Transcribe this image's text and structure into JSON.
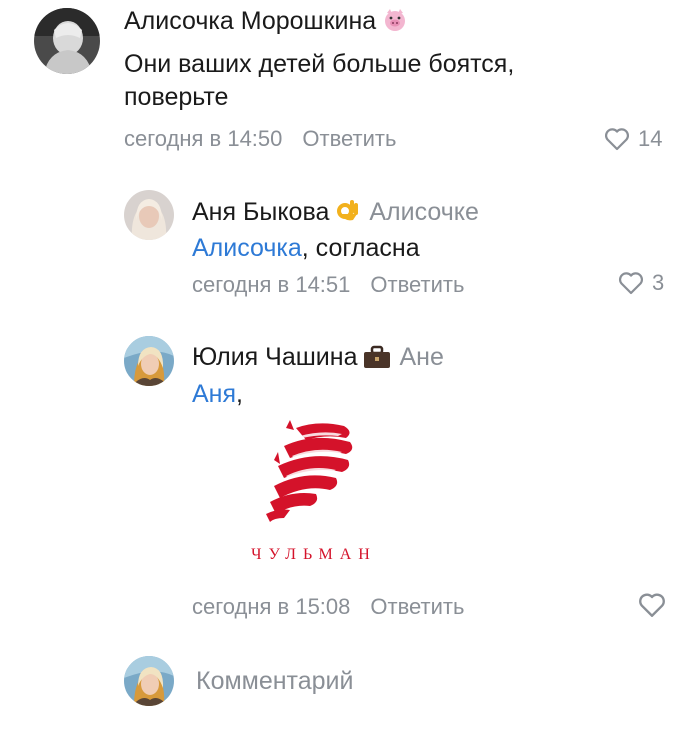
{
  "comments": [
    {
      "author": "Алисочка Морошкина",
      "text": "Они ваших детей больше боятся, поверьте",
      "time": "сегодня в 14:50",
      "reply_label": "Ответить",
      "likes": "14",
      "badge_icon": "piglet-emoji-icon"
    },
    {
      "author": "Аня Быкова",
      "reply_to": "Алисочке",
      "mention": "Алисочка",
      "text": ", согласна",
      "time": "сегодня в 14:51",
      "reply_label": "Ответить",
      "likes": "3",
      "badge_icon": "ok-hand-emoji-icon"
    },
    {
      "author": "Юлия Чашина",
      "reply_to": "Ане",
      "mention": "Аня",
      "text": ",",
      "time": "сегодня в 15:08",
      "reply_label": "Ответить",
      "likes": "",
      "badge_icon": "briefcase-emoji-icon",
      "attachment": {
        "caption": "ЧУЛЬМАН",
        "color": "#d4122a"
      }
    }
  ],
  "composer": {
    "placeholder": "Комментарий"
  },
  "colors": {
    "mention": "#2e7ad6",
    "muted": "#8a8f96",
    "text": "#1a1a1a"
  }
}
